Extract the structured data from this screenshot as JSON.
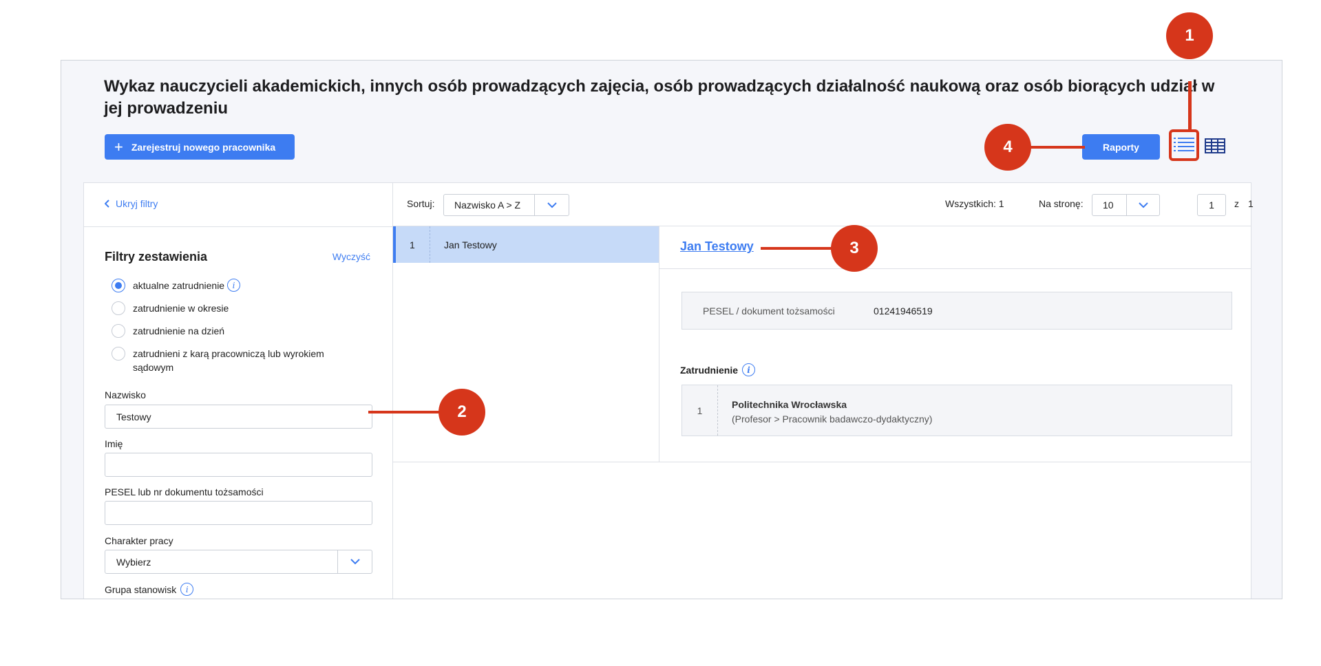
{
  "page": {
    "title": "Wykaz nauczycieli akademickich, innych osób prowadzących zajęcia, osób prowadzących działalność naukową oraz osób biorących udział w jej prowadzeniu",
    "register_button": "Zarejestruj nowego pracownika",
    "reports_button": "Raporty"
  },
  "filters": {
    "hide_label": "Ukryj filtry",
    "title": "Filtry zestawienia",
    "clear_label": "Wyczyść",
    "options": [
      "aktualne zatrudnienie",
      "zatrudnienie w okresie",
      "zatrudnienie na dzień",
      "zatrudnieni z karą pracowniczą lub wyrokiem sądowym"
    ],
    "selected_option": "aktualne zatrudnienie",
    "surname_label": "Nazwisko",
    "surname_value": "Testowy",
    "firstname_label": "Imię",
    "firstname_value": "",
    "pesel_label": "PESEL lub nr dokumentu tożsamości",
    "pesel_value": "",
    "work_type_label": "Charakter pracy",
    "work_type_value": "Wybierz",
    "position_group_label": "Grupa stanowisk"
  },
  "toolbar": {
    "sort_label": "Sortuj:",
    "sort_value": "Nazwisko A > Z",
    "total_label": "Wszystkich: 1",
    "per_page_label": "Na stronę:",
    "per_page_value": "10",
    "page_current": "1",
    "page_of": "z",
    "page_total": "1"
  },
  "list": {
    "rows": [
      {
        "num": "1",
        "name": "Jan Testowy"
      }
    ]
  },
  "detail": {
    "name": "Jan Testowy",
    "pesel_label": "PESEL / dokument tożsamości",
    "pesel_value": "01241946519",
    "employment_label": "Zatrudnienie",
    "employment": [
      {
        "num": "1",
        "organization": "Politechnika Wrocławska",
        "role": "(Profesor > Pracownik badawczo-dydaktyczny)"
      }
    ]
  },
  "annotations": {
    "badge1": "1",
    "badge2": "2",
    "badge3": "3",
    "badge4": "4"
  },
  "colors": {
    "accent": "#3d7cf1",
    "annotation": "#d6361b",
    "selected_row": "#c6daf8",
    "panel_bg": "#f5f6fa"
  }
}
